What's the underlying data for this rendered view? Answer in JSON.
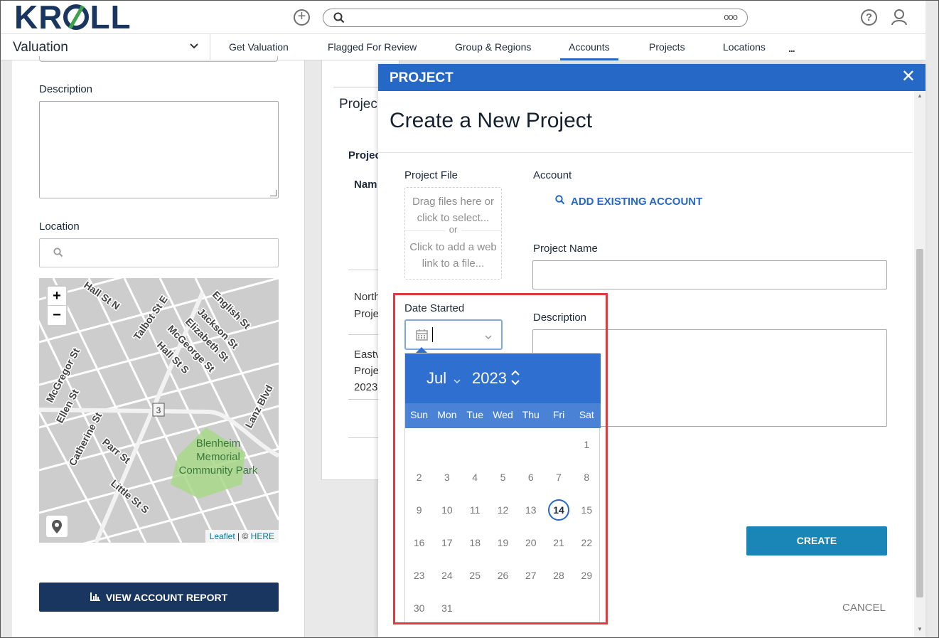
{
  "header": {
    "logo": "KROLL",
    "search_more": "ooo"
  },
  "nav": {
    "module": "Valuation",
    "items": [
      {
        "label": "Get Valuation"
      },
      {
        "label": "Flagged For Review"
      },
      {
        "label": "Group & Regions"
      },
      {
        "label": "Accounts",
        "active": true
      },
      {
        "label": "Projects"
      },
      {
        "label": "Locations"
      }
    ],
    "more": "..."
  },
  "left_panel": {
    "description_label": "Description",
    "location_label": "Location",
    "map": {
      "streets": [
        "Hall St N",
        "Talbot St E",
        "English St",
        "Jackson St",
        "Elizabeth St",
        "McGeorge St",
        "Hall St S",
        "McGregor St",
        "Ellen St",
        "Catherine St",
        "Parr St",
        "Little St S",
        "Lanz Blvd"
      ],
      "route": "3",
      "park": [
        "Blenheim",
        "Memorial",
        "Community Park"
      ],
      "attribution_leaflet": "Leaflet",
      "attribution_sep": " | © ",
      "attribution_here": "HERE"
    },
    "report_button": "VIEW ACCOUNT REPORT"
  },
  "middle": {
    "heading": "Projec",
    "sub": "Projec",
    "col": "Nam",
    "row1_a": "North",
    "row1_b": "Proje",
    "row2_a": "Eastv",
    "row2_b": "Proje",
    "row2_c": "2023"
  },
  "modal": {
    "header": "PROJECT",
    "title": "Create a New Project",
    "project_file_label": "Project File",
    "dropzone_drag": "Drag files here or click to select...",
    "dropzone_or": "or",
    "dropzone_link": "Click to add a web link to a file...",
    "account_label": "Account",
    "add_account": "ADD EXISTING ACCOUNT",
    "project_name_label": "Project Name",
    "date_started_label": "Date Started",
    "description_label": "Description",
    "create_button": "CREATE",
    "cancel_button": "CANCEL"
  },
  "calendar": {
    "month": "Jul",
    "year": "2023",
    "weekdays": [
      "Sun",
      "Mon",
      "Tue",
      "Wed",
      "Thu",
      "Fri",
      "Sat"
    ],
    "weeks": [
      [
        "",
        "",
        "",
        "",
        "",
        "",
        "1"
      ],
      [
        "2",
        "3",
        "4",
        "5",
        "6",
        "7",
        "8"
      ],
      [
        "9",
        "10",
        "11",
        "12",
        "13",
        "14",
        "15"
      ],
      [
        "16",
        "17",
        "18",
        "19",
        "20",
        "21",
        "22"
      ],
      [
        "23",
        "24",
        "25",
        "26",
        "27",
        "28",
        "29"
      ],
      [
        "30",
        "31",
        "",
        "",
        "",
        "",
        ""
      ]
    ],
    "today": "14"
  },
  "colors": {
    "brand_navy": "#18365f",
    "accent_blue": "#2568c5",
    "create_teal": "#1a86b8",
    "highlight_red": "#e5393f"
  }
}
